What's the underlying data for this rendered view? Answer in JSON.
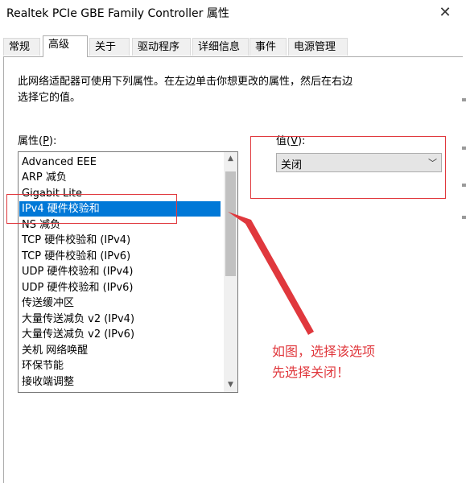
{
  "window": {
    "title": "Realtek PCIe GBE Family Controller 属性",
    "close_icon": "✕"
  },
  "tabs": [
    {
      "label": "常规"
    },
    {
      "label": "高级",
      "active": true
    },
    {
      "label": "关于"
    },
    {
      "label": "驱动程序"
    },
    {
      "label": "详细信息"
    },
    {
      "label": "事件"
    },
    {
      "label": "电源管理"
    }
  ],
  "description": {
    "line1": "此网络适配器可使用下列属性。在左边单击你想更改的属性，然后在右边",
    "line2": "选择它的值。"
  },
  "property": {
    "label": "属性(",
    "hotkey": "P",
    "label_end": "):",
    "items": [
      "Advanced EEE",
      "ARP 减负",
      "Gigabit Lite",
      "IPv4 硬件校验和",
      "NS 减负",
      "TCP 硬件校验和 (IPv4)",
      "TCP 硬件校验和 (IPv6)",
      "UDP 硬件校验和 (IPv4)",
      "UDP 硬件校验和 (IPv6)",
      "传送缓冲区",
      "大量传送减负 v2 (IPv4)",
      "大量传送减负 v2 (IPv6)",
      "关机 网络唤醒",
      "环保节能",
      "接收端调整"
    ],
    "selected": "IPv4 硬件校验和"
  },
  "value": {
    "label": "值(",
    "hotkey": "V",
    "label_end": "):",
    "selected": "关闭"
  },
  "annotation": {
    "line1": "如图，选择该选项",
    "line2": "先选择关闭！"
  },
  "colors": {
    "accent": "#0078d7",
    "annotation": "#e0383d"
  }
}
